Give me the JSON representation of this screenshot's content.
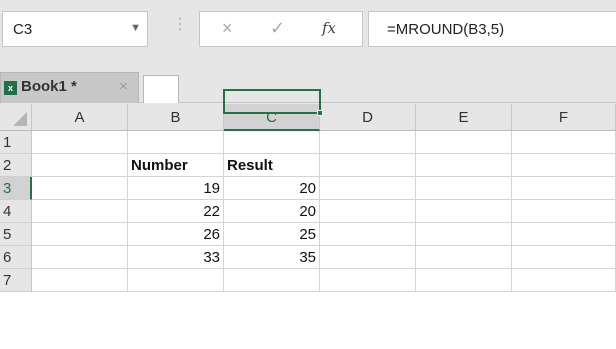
{
  "formula_bar": {
    "name_box": "C3",
    "cancel_icon": "×",
    "enter_icon": "✓",
    "fx_label": "fx",
    "formula": "=MROUND(B3,5)"
  },
  "tabs": [
    {
      "label": "Book1 *",
      "close": "×",
      "icon": "excel-icon"
    }
  ],
  "grid": {
    "columns": [
      "A",
      "B",
      "C",
      "D",
      "E",
      "F"
    ],
    "rows": [
      "1",
      "2",
      "3",
      "4",
      "5",
      "6",
      "7"
    ],
    "selected_column": "C",
    "selected_row": "3",
    "active_cell": "C3",
    "headers": {
      "B2": "Number",
      "C2": "Result"
    },
    "values": [
      {
        "b": "19",
        "c": "20"
      },
      {
        "b": "22",
        "c": "20"
      },
      {
        "b": "26",
        "c": "25"
      },
      {
        "b": "33",
        "c": "35"
      }
    ]
  },
  "colors": {
    "accent": "#217346",
    "excel_icon": "#1f7246"
  }
}
